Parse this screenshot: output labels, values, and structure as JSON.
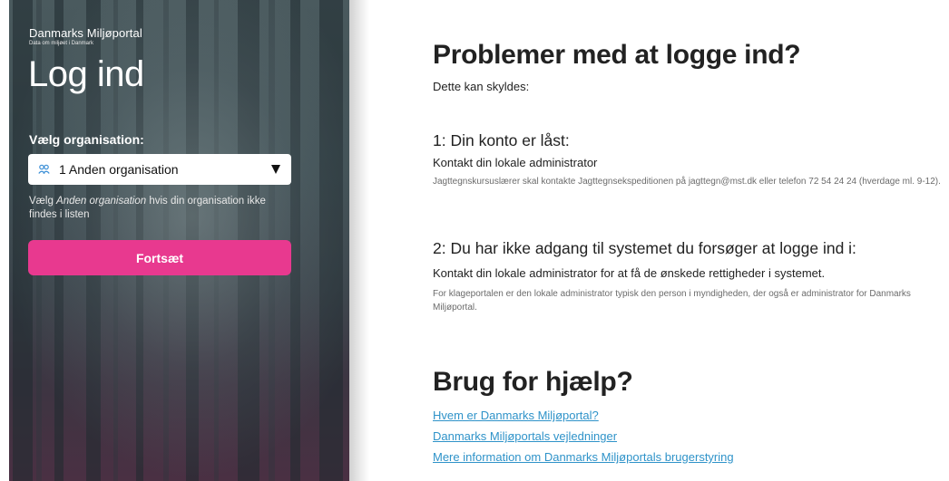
{
  "brand": {
    "name": "Danmarks Miljøportal",
    "tagline": "Data om miljøet i Danmark"
  },
  "login": {
    "title": "Log ind",
    "org_label": "Vælg organisation:",
    "org_selected": "1 Anden organisation",
    "org_hint_prefix": "Vælg ",
    "org_hint_emphasis": "Anden organisation",
    "org_hint_suffix": " hvis din organisation ikke findes i listen",
    "continue_label": "Fortsæt"
  },
  "problems": {
    "title": "Problemer med at logge ind?",
    "intro": "Dette kan skyldes:",
    "items": [
      {
        "heading": "1: Din konto er låst:",
        "text": "Kontakt din lokale administrator",
        "note": "Jagttegnskursuslærer skal kontakte Jagttegnsekspeditionen på jagttegn@mst.dk eller telefon 72 54 24 24 (hverdage ml. 9-12)."
      },
      {
        "heading": "2: Du har ikke adgang til systemet du forsøger at logge ind i:",
        "text": "Kontakt din lokale administrator for at få de ønskede rettigheder i systemet.",
        "note": "For klageportalen er den lokale administrator typisk den person i myndigheden, der også er administrator for Danmarks Miljøportal."
      }
    ]
  },
  "help": {
    "title": "Brug for hjælp?",
    "links": [
      "Hvem er Danmarks Miljøportal?",
      "Danmarks Miljøportals vejledninger",
      "Mere information om Danmarks Miljøportals brugerstyring"
    ]
  },
  "colors": {
    "accent": "#e8398f",
    "link": "#2f93c9",
    "heading": "#222222"
  }
}
